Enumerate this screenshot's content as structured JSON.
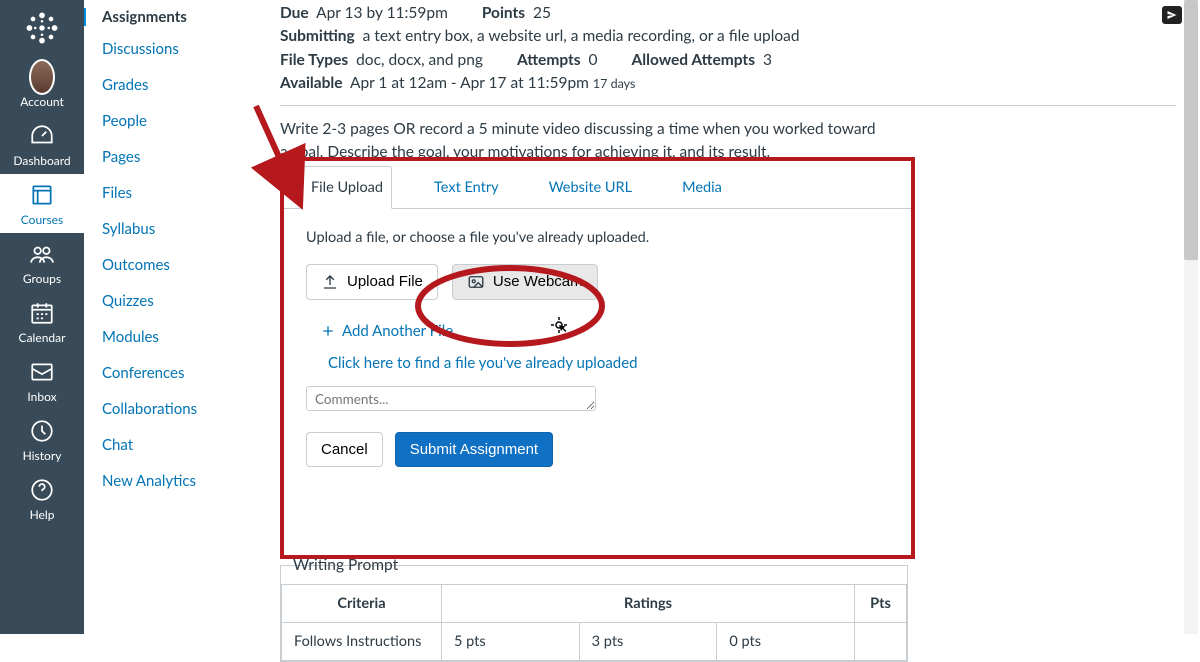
{
  "globalNav": {
    "items": [
      {
        "key": "account",
        "label": "Account"
      },
      {
        "key": "dashboard",
        "label": "Dashboard"
      },
      {
        "key": "courses",
        "label": "Courses"
      },
      {
        "key": "groups",
        "label": "Groups"
      },
      {
        "key": "calendar",
        "label": "Calendar"
      },
      {
        "key": "inbox",
        "label": "Inbox"
      },
      {
        "key": "history",
        "label": "History"
      },
      {
        "key": "help",
        "label": "Help"
      }
    ]
  },
  "courseNav": {
    "active": "Assignments",
    "links": [
      "Discussions",
      "Grades",
      "People",
      "Pages",
      "Files",
      "Syllabus",
      "Outcomes",
      "Quizzes",
      "Modules",
      "Conferences",
      "Collaborations",
      "Chat",
      "New Analytics"
    ]
  },
  "meta": {
    "dueLabel": "Due",
    "dueValue": "Apr 13 by 11:59pm",
    "pointsLabel": "Points",
    "pointsValue": "25",
    "submittingLabel": "Submitting",
    "submittingValue": "a text entry box, a website url, a media recording, or a file upload",
    "fileTypesLabel": "File Types",
    "fileTypesValue": "doc, docx, and png",
    "attemptsLabel": "Attempts",
    "attemptsValue": "0",
    "allowedLabel": "Allowed Attempts",
    "allowedValue": "3",
    "availableLabel": "Available",
    "availableValue": "Apr 1 at 12am - Apr 17 at 11:59pm",
    "availableDays": "17 days"
  },
  "description": "Write 2-3 pages OR record a 5 minute video discussing a time when you worked toward a goal. Describe the goal, your motivations for achieving it, and its result.",
  "tabs": [
    "File Upload",
    "Text Entry",
    "Website URL",
    "Media"
  ],
  "upload": {
    "prompt": "Upload a file, or choose a file you've already uploaded.",
    "uploadLabel": "Upload File",
    "webcamLabel": "Use Webcam",
    "addAnother": "Add Another File",
    "findFile": "Click here to find a file you've already uploaded",
    "commentsPlaceholder": "Comments...",
    "cancel": "Cancel",
    "submit": "Submit Assignment"
  },
  "rubric": {
    "title": "Writing Prompt",
    "headers": {
      "criteria": "Criteria",
      "ratings": "Ratings",
      "pts": "Pts"
    },
    "rows": [
      {
        "criteria": "Follows Instructions",
        "ratings": [
          "5 pts",
          "3 pts",
          "0 pts"
        ]
      }
    ]
  }
}
